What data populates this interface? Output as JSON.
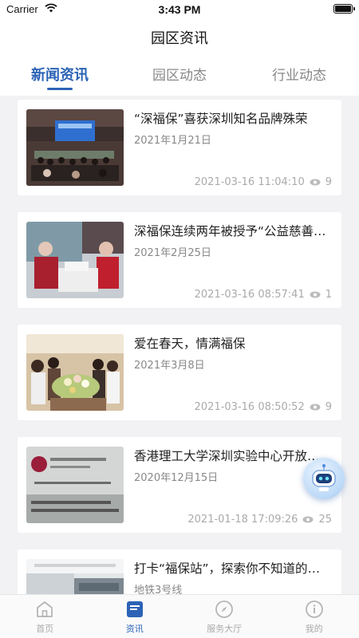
{
  "status_bar": {
    "carrier": "Carrier",
    "time": "3:43 PM"
  },
  "nav": {
    "title": "园区资讯"
  },
  "tabs": [
    {
      "label": "新闻资讯",
      "active": true
    },
    {
      "label": "园区动态",
      "active": false
    },
    {
      "label": "行业动态",
      "active": false
    }
  ],
  "articles": [
    {
      "title": "“深福保”喜获深圳知名品牌殊荣",
      "subtitle": "2021年1月21日",
      "timestamp": "2021-03-16 11:04:10",
      "views": "9",
      "thumb_icon": "conference-photo-icon"
    },
    {
      "title": "深福保连续两年被授予“公益慈善单位”",
      "subtitle": "2021年2月25日",
      "timestamp": "2021-03-16 08:57:41",
      "views": "1",
      "thumb_icon": "charity-photo-icon"
    },
    {
      "title": "爱在春天，情满福保",
      "subtitle": "2021年3月8日",
      "timestamp": "2021-03-16 08:50:52",
      "views": "9",
      "thumb_icon": "flowers-photo-icon"
    },
    {
      "title": "香港理工大学深圳实验中心开放日活动",
      "subtitle": "2020年12月15日",
      "timestamp": "2021-01-18 17:09:26",
      "views": "25",
      "thumb_icon": "lab-sign-photo-icon"
    },
    {
      "title": "打卡“福保站”，探索你不知道的地铁站",
      "subtitle": "地铁3号线",
      "timestamp": "",
      "views": "",
      "thumb_icon": "metro-photo-icon"
    }
  ],
  "tabbar": [
    {
      "label": "首页",
      "icon": "home-icon",
      "active": false
    },
    {
      "label": "资讯",
      "icon": "news-icon",
      "active": true
    },
    {
      "label": "服务大厅",
      "icon": "compass-icon",
      "active": false
    },
    {
      "label": "我的",
      "icon": "profile-icon",
      "active": false
    }
  ],
  "colors": {
    "accent": "#2c63b6",
    "muted": "#aaaaaa",
    "background": "#f2f2f4"
  }
}
